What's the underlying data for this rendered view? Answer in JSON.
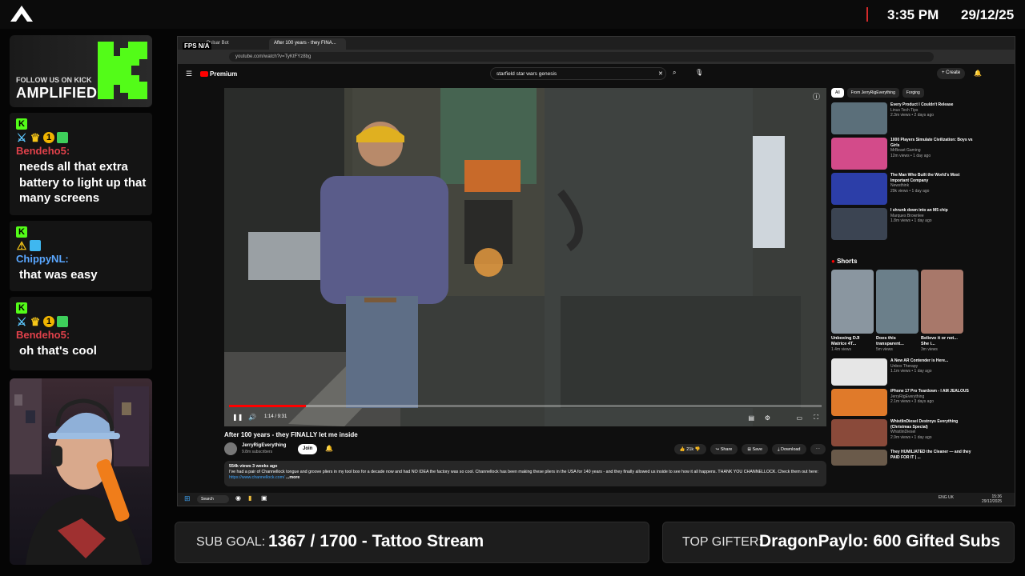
{
  "overlay": {
    "clock": "3:35 PM",
    "date": "29/12/25",
    "kick_banner": {
      "follow_text": "FOLLOW US ON KICK",
      "brand": "AMPLIFIED"
    },
    "chat": [
      {
        "user": "Bendeho5:",
        "user_color": "#e0414a",
        "message": "needs all that extra battery to light up that many screens",
        "badges": [
          "kick",
          "sword",
          "crown",
          "one",
          "cube"
        ]
      },
      {
        "user": "ChippyNL:",
        "user_color": "#5aa7ff",
        "message": "that was easy",
        "badges": [
          "kick",
          "warn",
          "cubeblue"
        ]
      },
      {
        "user": "Bendeho5:",
        "user_color": "#e0414a",
        "message": "oh that's cool",
        "badges": [
          "kick",
          "sword",
          "crown",
          "one",
          "cube"
        ]
      }
    ],
    "sub_goal": {
      "label": "SUB GOAL:",
      "value": "1367 / 1700 - Tattoo Stream"
    },
    "top_gifter": {
      "label": "TOP GIFTER:",
      "value": "DragonPaylo: 600 Gifted Subs"
    }
  },
  "browser": {
    "fps": "FPS N/A",
    "tabs": [
      "Pulsar Bot",
      "After 100 years - they FINA..."
    ],
    "url": "youtube.com/watch?v=TyKtFYz8bg"
  },
  "youtube": {
    "brand": "Premium",
    "search_query": "starfield star wars genesis",
    "create_label": "Create",
    "player_time": "1:14 / 9:31",
    "progress": 0.13,
    "video_title": "After 100 years - they FINALLY let me inside",
    "channel": "JerryRigEverything",
    "subscribers": "9.8m subscribers",
    "join_label": "Join",
    "actions": [
      "21k",
      "Share",
      "Save",
      "Download"
    ],
    "description_meta": "554k views  3 weeks ago",
    "description": "I've had a pair of Channellock tongue and groove pliers in my tool box for a decade now and had NO IDEA the factory was so cool. Channellock has been making these pliers in the USA for 140 years - and they finally allowed us inside to see how it all happens. THANK YOU CHANNELLOCK. Check them out here:",
    "description_link": "https://www.channellock.com/",
    "description_more": "...more",
    "chips": [
      "All",
      "From JerryRigEverything",
      "Forging"
    ],
    "recommended": [
      {
        "title": "Every Product I Couldn't Release",
        "channel": "Linus Tech Tips",
        "meta": "2.3m views • 2 days ago",
        "color": "#5b6f7a"
      },
      {
        "title": "1000 Players Simulate Civilization: Boys vs Girls",
        "channel": "MrBeast Gaming",
        "meta": "12m views • 1 day ago",
        "color": "#d34b8a"
      },
      {
        "title": "The Man Who Built the World's Most Important Company",
        "channel": "Newsthink",
        "meta": "29k views • 1 day ago",
        "color": "#2c3ea8"
      },
      {
        "title": "I shrunk down into an M5 chip",
        "channel": "Marques Brownlee",
        "meta": "1.8m views • 1 day ago",
        "color": "#3b4452"
      }
    ],
    "shorts_title": "Shorts",
    "shorts": [
      {
        "label": "Unboxing DJI Matrice 4T...",
        "views": "1.4m views",
        "color": "#8a96a0"
      },
      {
        "label": "Does this transparent...",
        "views": "5m views",
        "color": "#6b7f8a"
      },
      {
        "label": "Believe it or not... She i...",
        "views": "3m views",
        "color": "#a8786a"
      }
    ],
    "recommended_more": [
      {
        "title": "A New AR Contender is Here...",
        "channel": "Unbox Therapy",
        "meta": "1.1m views • 1 day ago",
        "color": "#e6e6e6"
      },
      {
        "title": "iPhone 17 Pro Teardown - I AM JEALOUS",
        "channel": "JerryRigEverything",
        "meta": "2.1m views • 3 days ago",
        "color": "#e07a2a"
      },
      {
        "title": "WhistlinDiesel Destroys Everything (Christmas Special)",
        "channel": "WhistlinDiesel",
        "meta": "2.9m views • 1 day ago",
        "color": "#8a4a3a"
      },
      {
        "title": "They HUMILIATED the Cleaner — and they PAID FOR IT | ...",
        "channel": "",
        "meta": "",
        "color": "#6a5a4a"
      }
    ],
    "taskbar": {
      "search": "Search",
      "lang": "ENG UK",
      "time": "15:36",
      "date": "29/12/2025"
    }
  }
}
